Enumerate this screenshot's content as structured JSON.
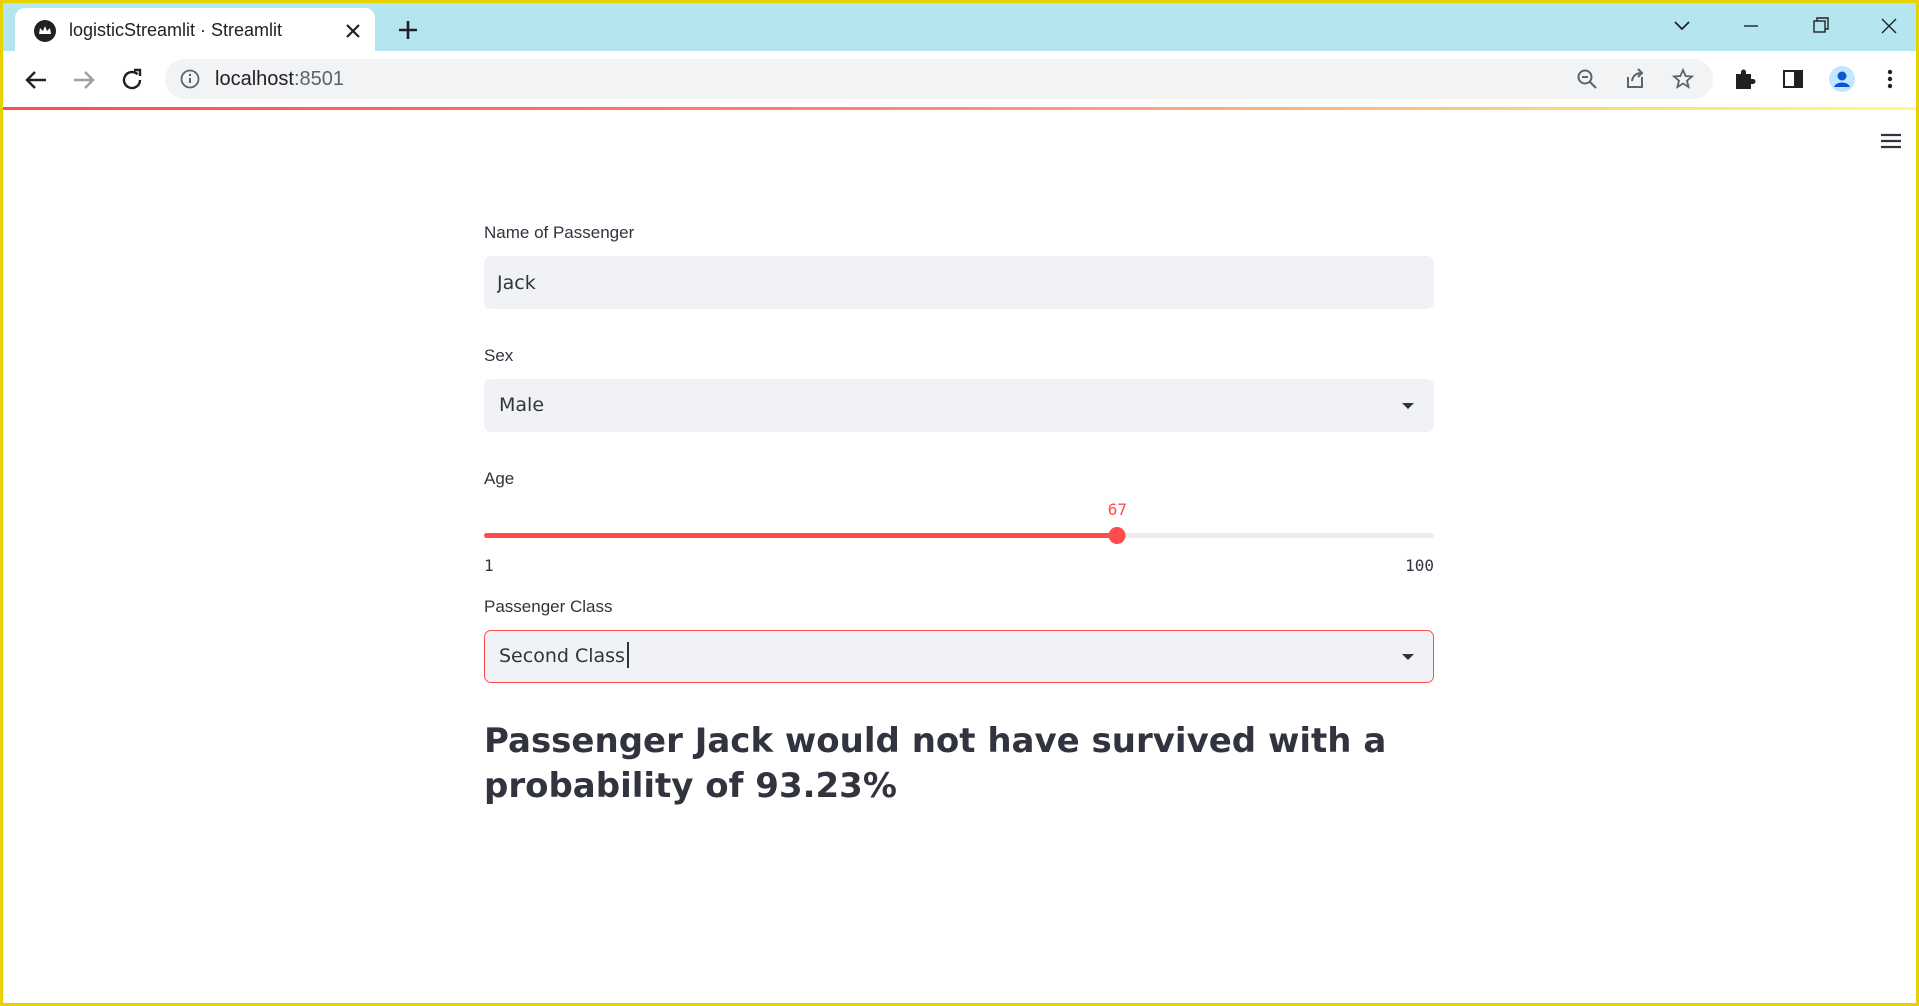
{
  "browser": {
    "tab_title": "logisticStreamlit · Streamlit",
    "url_host": "localhost",
    "url_port": ":8501"
  },
  "colors": {
    "primary": "#ff4b4b",
    "text": "#31333f",
    "input_bg": "#f0f2f6",
    "tabstrip_bg": "#b5e6ef"
  },
  "form": {
    "name": {
      "label": "Name of Passenger",
      "value": "Jack"
    },
    "sex": {
      "label": "Sex",
      "value": "Male"
    },
    "age": {
      "label": "Age",
      "value": 67,
      "min": 1,
      "max": 100
    },
    "passenger_class": {
      "label": "Passenger Class",
      "value": "Second Class"
    }
  },
  "result": {
    "text": "Passenger Jack would not have survived with a probability of 93.23%"
  }
}
